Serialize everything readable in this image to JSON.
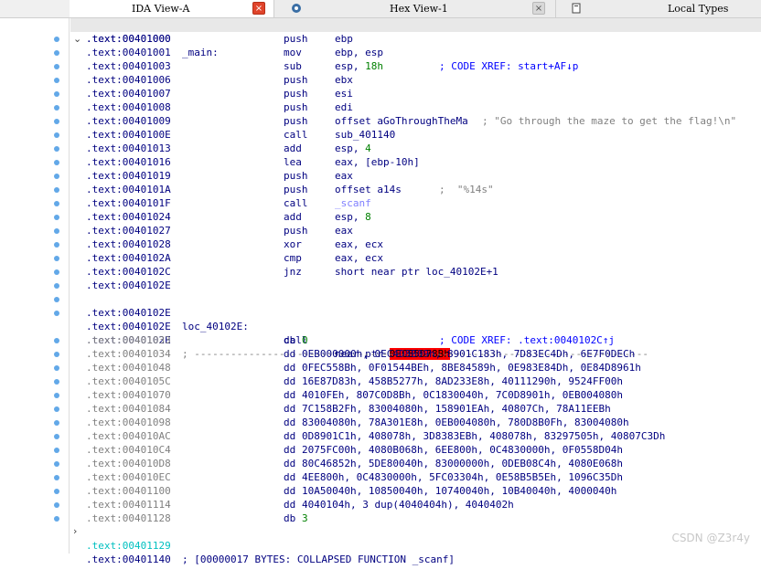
{
  "tabs": [
    {
      "label": "IDA View-A",
      "active": true,
      "close": "×"
    },
    {
      "label": "Hex View-1",
      "active": false,
      "close": "×"
    },
    {
      "label": "Local Types",
      "active": false,
      "close": ""
    }
  ],
  "listing": {
    "header": {
      "addr": ".text:00401000",
      "label": "_main:",
      "xref": "; CODE XREF: start+AF↓p"
    },
    "rows": [
      {
        "addr": ".text:00401000",
        "mn": "push",
        "op": "ebp"
      },
      {
        "addr": ".text:00401001",
        "mn": "mov",
        "op": "ebp, esp"
      },
      {
        "addr": ".text:00401003",
        "mn": "sub",
        "op": "esp, ",
        "num": "18h"
      },
      {
        "addr": ".text:00401006",
        "mn": "push",
        "op": "ebx"
      },
      {
        "addr": ".text:00401007",
        "mn": "push",
        "op": "esi"
      },
      {
        "addr": ".text:00401008",
        "mn": "push",
        "op": "edi"
      },
      {
        "addr": ".text:00401009",
        "mn": "push",
        "op": "offset aGoThroughTheMa",
        "cm": "; \"Go through the maze to get the flag!\\n\"",
        "cmx": 527
      },
      {
        "addr": ".text:0040100E",
        "mn": "call",
        "op": "sub_401140"
      },
      {
        "addr": ".text:00401013",
        "mn": "add",
        "op": "esp, ",
        "num": "4"
      },
      {
        "addr": ".text:00401016",
        "mn": "lea",
        "op": "eax, [ebp-10h]"
      },
      {
        "addr": ".text:00401019",
        "mn": "push",
        "op": "eax"
      },
      {
        "addr": ".text:0040101A",
        "mn": "push",
        "op": "offset a14s",
        "cm": ";  \"%14s\"",
        "cmx": 480
      },
      {
        "addr": ".text:0040101F",
        "mn": "call",
        "func": "_scanf"
      },
      {
        "addr": ".text:00401024",
        "mn": "add",
        "op": "esp, ",
        "num": "8"
      },
      {
        "addr": ".text:00401027",
        "mn": "push",
        "op": "eax"
      },
      {
        "addr": ".text:00401028",
        "mn": "xor",
        "op": "eax, ecx"
      },
      {
        "addr": ".text:0040102A",
        "mn": "cmp",
        "op": "eax, ecx"
      },
      {
        "addr": ".text:0040102C",
        "mn": "jnz",
        "op": "short near ptr loc_40102E+1"
      },
      {
        "addr": ".text:0040102E"
      }
    ],
    "loc_row": {
      "addr": ".text:0040102E",
      "label": "loc_40102E:",
      "xref": "; CODE XREF: .text:0040102C↑j"
    },
    "call_row": {
      "addr": ".text:0040102E",
      "mn": "call",
      "op": "near ptr ",
      "bad": "0EC85D78Bh"
    },
    "sep_row": {
      "addr": ".text:0040102E",
      "sep": "; ---------------------------------------------------------------------------"
    },
    "data_rows": [
      {
        "addr": ".text:00401033",
        "mn": "db",
        "num": "0"
      },
      {
        "addr": ".text:00401034",
        "mn": "dd",
        "op": "0EB000000h, 0EC4D8B09h, 8901C183h, 7D83EC4Dh, 6E7F0DECh"
      },
      {
        "addr": ".text:00401048",
        "mn": "dd",
        "op": "0FEC558Bh, 0F01544BEh, 8BE84589h, 0E983E84Dh, 0E84D8961h"
      },
      {
        "addr": ".text:0040105C",
        "mn": "dd",
        "op": "16E87D83h, 458B5277h, 8AD233E8h, 40111290h, 9524FF00h"
      },
      {
        "addr": ".text:00401070",
        "mn": "dd",
        "op": "4010FEh, 807C0D8Bh, 0C1830040h, 7C0D8901h, 0EB004080h"
      },
      {
        "addr": ".text:00401084",
        "mn": "dd",
        "op": "7C158B2Fh, 83004080h, 158901EAh, 40807Ch, 78A11EEBh"
      },
      {
        "addr": ".text:00401098",
        "mn": "dd",
        "op": "83004080h, 78A301E8h, 0EB004080h, 780D8B0Fh, 83004080h"
      },
      {
        "addr": ".text:004010AC",
        "mn": "dd",
        "op": "0D8901C1h, 408078h, 3D8383EBh, 408078h, 83297505h, 40807C3Dh"
      },
      {
        "addr": ".text:004010C4",
        "mn": "dd",
        "op": "2075FC00h, 4080B068h, 6EE800h, 0C4830000h, 0F0558D04h"
      },
      {
        "addr": ".text:004010D8",
        "mn": "dd",
        "op": "80C46852h, 5DE80040h, 83000000h, 0DEB08C4h, 4080E068h"
      },
      {
        "addr": ".text:004010EC",
        "mn": "dd",
        "op": "4EE800h, 0C4830000h, 5FC03304h, 0E58B5B5Eh, 1096C35Dh"
      },
      {
        "addr": ".text:00401100",
        "mn": "dd",
        "op": "10A50040h, 10850040h, 10740040h, 10B40040h, 4000040h"
      },
      {
        "addr": ".text:00401114",
        "mn": "dd",
        "op": "4040104h, 3 dup(4040404h), 4040402h"
      },
      {
        "addr": ".text:00401128",
        "mn": "db",
        "num": "3"
      }
    ],
    "collapsed_row": {
      "addr": ".text:00401129",
      "text": "; [00000017 BYTES: COLLAPSED FUNCTION _scanf]"
    },
    "last_row": {
      "addr": ".text:00401140"
    }
  },
  "watermark": "CSDN @Z3r4y"
}
